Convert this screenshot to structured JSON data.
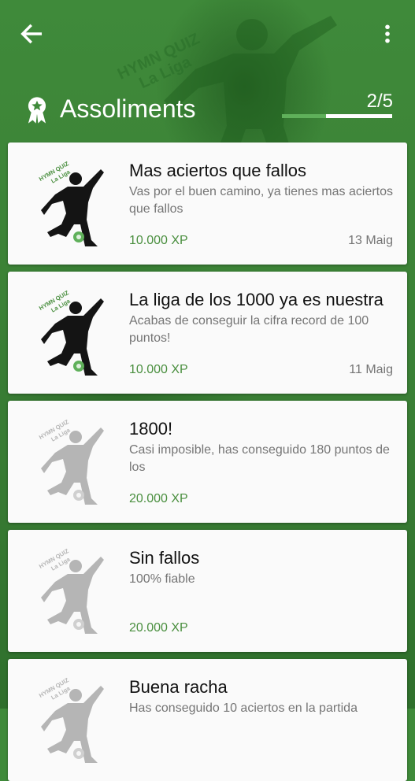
{
  "topbar": {
    "back_icon": "arrow-left-icon",
    "menu_icon": "more-vertical-icon"
  },
  "section": {
    "title": "Assoliments",
    "icon": "award-ribbon-icon",
    "progress_text": "2/5",
    "progress_fraction": 0.4
  },
  "colors": {
    "accent_green": "#4a8f3f",
    "header_green": "#3f8a3a",
    "locked_gray": "#b5b5b5",
    "unlocked_black": "#141414"
  },
  "achievements": [
    {
      "title": "Mas aciertos que fallos",
      "description": "Vas por el buen camino, ya tienes mas aciertos que fallos",
      "xp": "10.000 XP",
      "date": "13 Maig",
      "unlocked": true
    },
    {
      "title": "La liga de los 1000 ya es nuestra",
      "description": "Acabas de conseguir la cifra record de 100 puntos!",
      "xp": "10.000 XP",
      "date": "11 Maig",
      "unlocked": true
    },
    {
      "title": "1800!",
      "description": "Casi imposible, has conseguido 180 puntos de los",
      "xp": "20.000 XP",
      "date": "",
      "unlocked": false
    },
    {
      "title": "Sin fallos",
      "description": "100% fiable",
      "xp": "20.000 XP",
      "date": "",
      "unlocked": false
    },
    {
      "title": "Buena racha",
      "description": "Has conseguido 10 aciertos en la partida",
      "xp": "",
      "date": "",
      "unlocked": false
    }
  ],
  "badge_text": {
    "line1": "HYMN QUIZ",
    "line2": "La Liga"
  }
}
